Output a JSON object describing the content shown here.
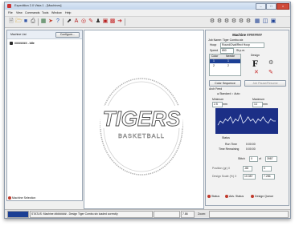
{
  "window": {
    "title": "Expedition 2.0 Vista 1 - [Machines]"
  },
  "menu": [
    "File",
    "View",
    "Commands",
    "Tools",
    "Window",
    "Help"
  ],
  "left_panel": {
    "machine_list_label": "Machine List",
    "configure_button": "Configure...",
    "machine_item": "######## - Idle",
    "machine_selection_tab": "Machine Selection"
  },
  "design": {
    "main_text": "TIGERS",
    "sub_text": "BASKETBALL"
  },
  "right_panel": {
    "title": "Machine ########",
    "job_name_label": "Job Name: Tiger Combo.stx",
    "hoop_label": "Hoop",
    "hoop_value": "Round/Oval/Rect Hoop",
    "speed_label": "Speed",
    "speed_value": "850",
    "speed_unit": "St.p.m.",
    "color_header": "Color",
    "needle_header": "Needle",
    "color_rows": [
      {
        "color": "1",
        "needle": "1"
      },
      {
        "color": "2",
        "needle": "2"
      }
    ],
    "design_label": "Design",
    "design_letter": "F",
    "color_sequence_button": "Color Sequence",
    "job_pause_button": "Job Pause/Resume",
    "arch_feed_label": "Arch Feed",
    "standard_label": "Standard",
    "auto_label": "Auto",
    "minimum_label": "Minimum",
    "minimum_value": "2.5",
    "maximum_label": "Maximum",
    "maximum_value": "14",
    "unit_mm": "mm",
    "status_label": "Status",
    "run_time_label": "Run Time",
    "run_time_value": "0:00:00",
    "time_remaining_label": "Time Remaining",
    "time_remaining_value": "0:00:00",
    "stitch_label": "Stitch",
    "stitch_value": "0",
    "stitch_of": "of",
    "stitch_total": "3987",
    "position_label": "Position (gr) X",
    "position_x": "-88",
    "position_y": "0",
    "design_scale_label": "Design Scale (%) X",
    "scale_x": "10.087",
    "scale_y": "7.286"
  },
  "tabs_bottom": [
    "Status",
    "Adv. Status",
    "Design Queue"
  ],
  "statusbar": {
    "left": "",
    "message": "STATUS: Machine ######## - Design Tiger Combo.stx loaded correctly",
    "value": "7.86",
    "zoom_label": "Zoom:"
  },
  "chart_data": {
    "type": "line",
    "title": "",
    "xlabel": "",
    "ylabel": "",
    "series": [
      {
        "values": [
          3,
          5,
          4,
          6,
          5,
          7,
          4,
          6,
          5,
          8,
          4,
          5,
          7,
          5,
          6,
          4,
          6,
          5,
          7,
          5,
          4,
          6,
          5,
          5
        ]
      }
    ],
    "ylim": [
      0,
      10
    ]
  },
  "colors": {
    "accent": "#1c3f94",
    "graph_bg": "#1c2f86",
    "graph_line": "#e8eefc",
    "status_dot": "#c0392b"
  }
}
